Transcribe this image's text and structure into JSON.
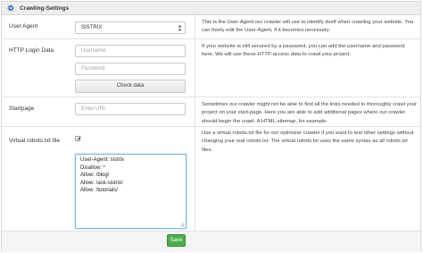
{
  "header": {
    "title": "Crawling-Settings",
    "icon": "gear-icon"
  },
  "user_agent": {
    "label": "User Agent",
    "value": "SISTRIX",
    "description": "This is the User-Agent our crawler will use to identify itself when crawling your website. You can freely edit the User-Agent, if it becomes necessary."
  },
  "http_login": {
    "label": "HTTP Login Data",
    "username_placeholder": "Username",
    "password_placeholder": "Password",
    "check_button": "Check data",
    "description": "If your website is still secured by a password, you can add the username and password here. We will use these HTTP-access data to crawl your project."
  },
  "startpage": {
    "label": "Startpage",
    "placeholder": "Enter URL",
    "description": "Sometimes our crawler might not be able to find all the links needed to thoroughly crawl your project on your start-page. Here you are able to add additional pages where our crawler should begin the crawl. A HTML-sitemap, for example."
  },
  "robots": {
    "label": "Virtual robots.txt file",
    "checked": true,
    "lines": [
      "User-Agent: sistrix",
      "Disallow: *",
      "Allow: /blog/",
      "Allow: /ask-sistrix/",
      "Allow: /tutorials/"
    ],
    "description": "Use a virtual robots.txt file for our optimizer crawler if you want to test other settings without changing your real robots.txt. The virtual robots.txt uses the same syntax as all robots.txt files."
  },
  "footer": {
    "save_button": "Save"
  },
  "colors": {
    "save": "#4cae4c",
    "focus_border": "#79b4e0",
    "header_bg": "#eeeeee"
  }
}
